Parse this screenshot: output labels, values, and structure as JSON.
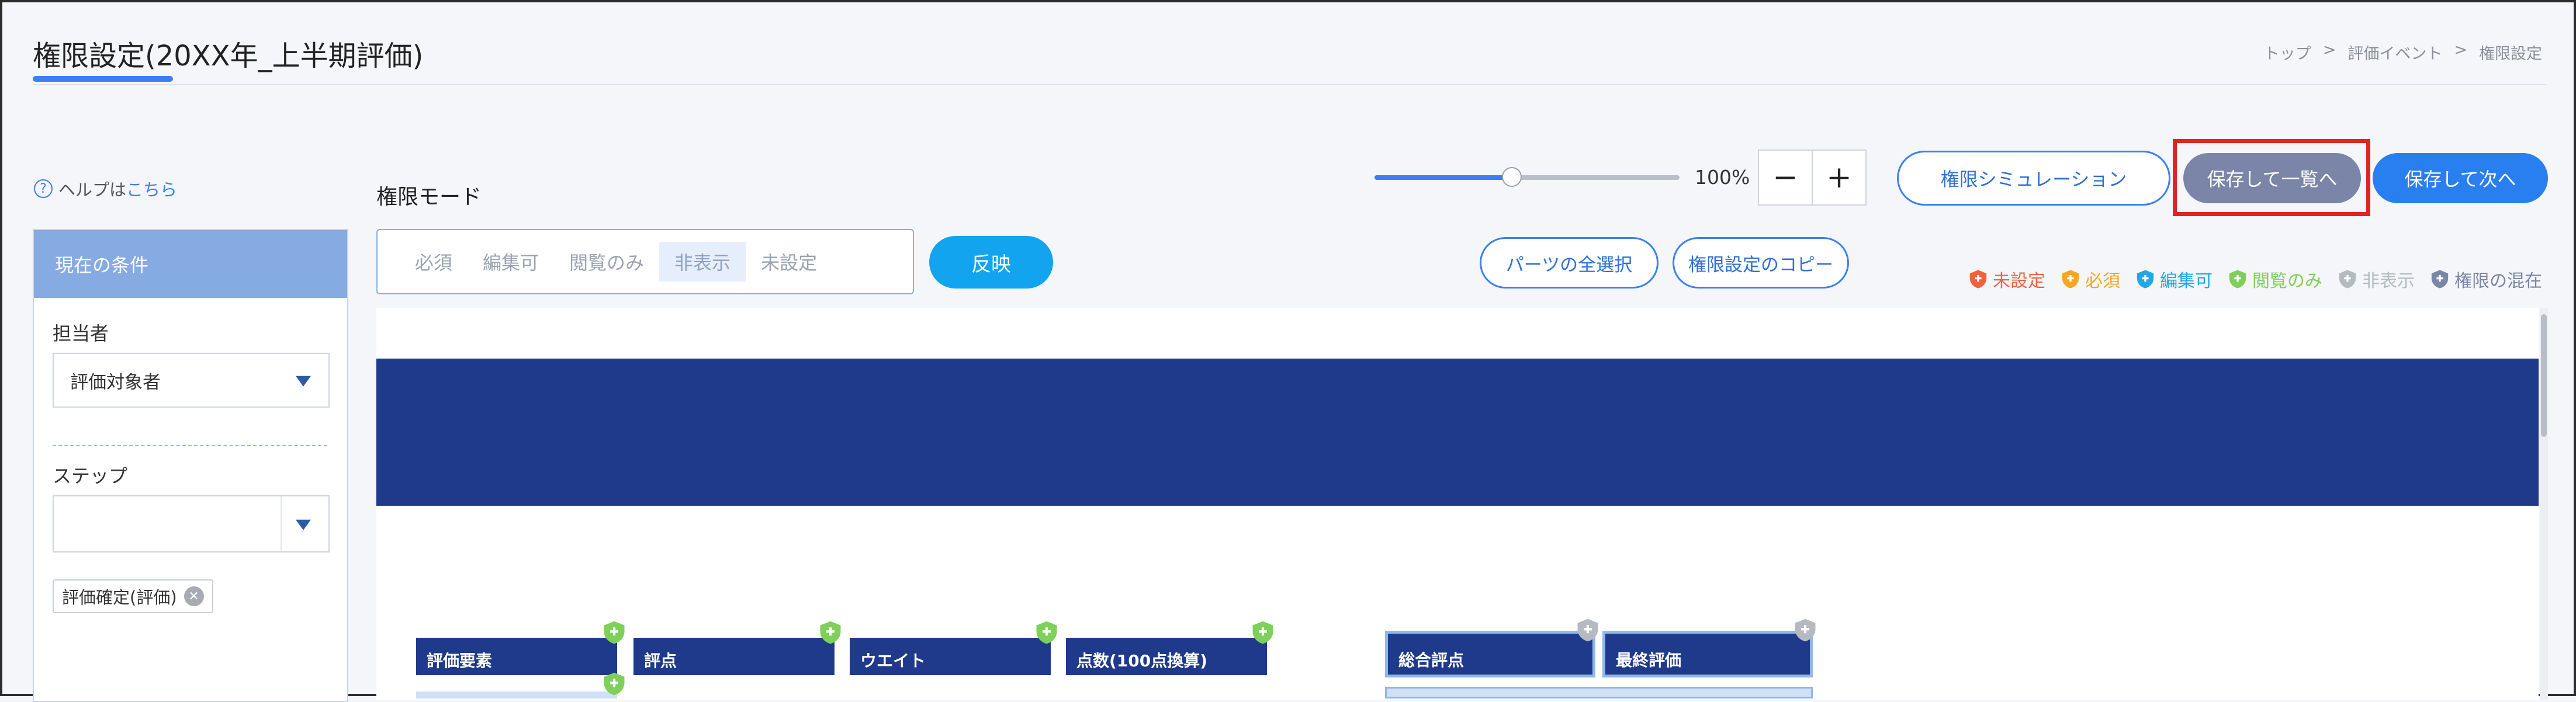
{
  "header": {
    "title": "権限設定(20XX年_上半期評価)",
    "breadcrumb": [
      "トップ",
      ">",
      "評価イベント",
      ">",
      "権限設定"
    ]
  },
  "help": {
    "prefix": "ヘルプは",
    "link": "こちら"
  },
  "conditions": {
    "title": "現在の条件",
    "assignee_label": "担当者",
    "assignee_value": "評価対象者",
    "step_label": "ステップ",
    "step_value": "",
    "chip": "評価確定(評価)"
  },
  "mode": {
    "label": "権限モード",
    "items": [
      "必須",
      "編集可",
      "閲覧のみ",
      "非表示",
      "未設定"
    ],
    "active_index": 3,
    "apply_label": "反映"
  },
  "zoom": {
    "value_text": "100%",
    "minus": "−",
    "plus": "+",
    "level": 0.45
  },
  "actions": {
    "simulation": "権限シミュレーション",
    "save_list": "保存して一覧へ",
    "save_next": "保存して次へ",
    "select_all": "パーツの全選択",
    "copy_settings": "権限設定のコピー"
  },
  "legend": [
    {
      "label": "未設定",
      "color": "#f0623e",
      "icon": "shield-plus-icon"
    },
    {
      "label": "必須",
      "color": "#f5a623",
      "icon": "shield-plus-icon"
    },
    {
      "label": "編集可",
      "color": "#20a8e8",
      "icon": "shield-plus-icon"
    },
    {
      "label": "閲覧のみ",
      "color": "#7ed05a",
      "icon": "shield-plus-icon"
    },
    {
      "label": "非表示",
      "color": "#b5b9c0",
      "icon": "shield-plus-icon"
    },
    {
      "label": "権限の混在",
      "color": "#7a85a8",
      "icon": "shield-plus-icon"
    }
  ],
  "parts": [
    {
      "label": "評価要素",
      "badge_color": "#7ed05a"
    },
    {
      "label": "評点",
      "badge_color": "#7ed05a"
    },
    {
      "label": "ウエイト",
      "badge_color": "#7ed05a"
    },
    {
      "label": "点数(100点換算)",
      "badge_color": "#7ed05a"
    },
    {
      "label": "総合評点",
      "badge_color": "#b5b9c0"
    },
    {
      "label": "最終評価",
      "badge_color": "#b5b9c0"
    }
  ]
}
